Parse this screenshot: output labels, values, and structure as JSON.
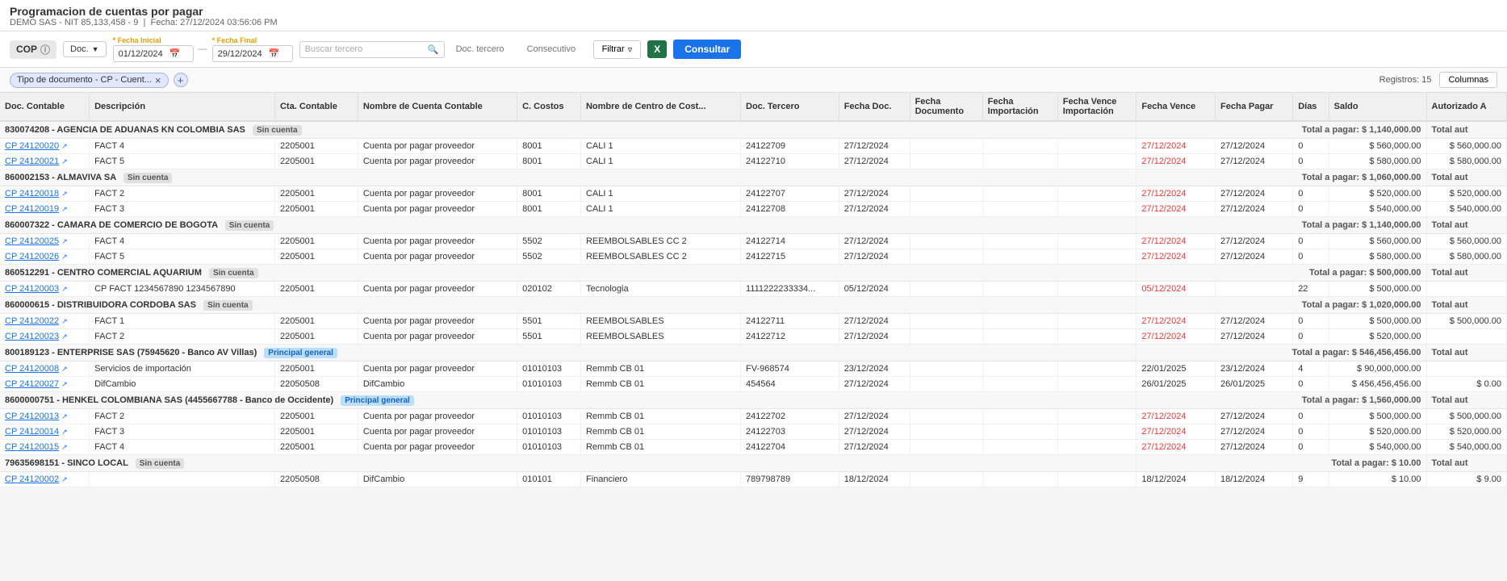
{
  "header": {
    "title": "Programacion de cuentas por pagar",
    "subtitle": "DEMO SAS - NIT 85,133,458 - 9",
    "date_label": "Fecha: 27/12/2024 03:56:06 PM"
  },
  "toolbar": {
    "currency": "COP",
    "doc_label": "Doc.",
    "fecha_inicial_label": "* Fecha Inicial",
    "fecha_inicial_value": "01/12/2024",
    "fecha_final_label": "* Fecha Final",
    "fecha_final_value": "29/12/2024",
    "buscar_tercero_placeholder": "Buscar tercero",
    "doc_tercero_placeholder": "Doc. tercero",
    "consecutivo_placeholder": "Consecutivo",
    "filtrar_label": "Filtrar",
    "consultar_label": "Consultar"
  },
  "filter_bar": {
    "tag_label": "Tipo de documento - CP - Cuent...",
    "records_label": "Registros: 15",
    "columns_label": "Columnas"
  },
  "table": {
    "columns": [
      "Doc. Contable",
      "Descripción",
      "Cta. Contable",
      "Nombre de Cuenta Contable",
      "C. Costos",
      "Nombre de Centro de Cost...",
      "Doc. Tercero",
      "Fecha Doc.",
      "Fecha Documento",
      "Fecha Importación",
      "Fecha Vence Importación",
      "Fecha Vence",
      "Fecha Pagar",
      "Días",
      "Saldo",
      "Autorizado A"
    ],
    "groups": [
      {
        "id": "g1",
        "group_label": "830074208 - AGENCIA DE ADUANAS KN COLOMBIA SAS",
        "badge": "Sin cuenta",
        "badge_type": "gray",
        "total_label": "Total a pagar: $ 1,140,000.00",
        "total_auth": "Total aut",
        "rows": [
          {
            "doc_contable": "CP 24120020",
            "descripcion": "FACT 4",
            "cta_contable": "2205001",
            "nombre_cuenta": "Cuenta por pagar proveedor",
            "c_costos": "8001",
            "nombre_centro": "CALI 1",
            "doc_tercero": "24122709",
            "fecha_doc": "27/12/2024",
            "fecha_documento": "",
            "fecha_importacion": "",
            "fecha_vence_imp": "",
            "fecha_vence": "27/12/2024",
            "fecha_pagar": "27/12/2024",
            "dias": "0",
            "saldo": "$ 560,000.00",
            "autorizado": "$ 560,000.00",
            "fecha_vence_red": true
          },
          {
            "doc_contable": "CP 24120021",
            "descripcion": "FACT 5",
            "cta_contable": "2205001",
            "nombre_cuenta": "Cuenta por pagar proveedor",
            "c_costos": "8001",
            "nombre_centro": "CALI 1",
            "doc_tercero": "24122710",
            "fecha_doc": "27/12/2024",
            "fecha_documento": "",
            "fecha_importacion": "",
            "fecha_vence_imp": "",
            "fecha_vence": "27/12/2024",
            "fecha_pagar": "27/12/2024",
            "dias": "0",
            "saldo": "$ 580,000.00",
            "autorizado": "$ 580,000.00",
            "fecha_vence_red": true
          }
        ]
      },
      {
        "id": "g2",
        "group_label": "860002153 - ALMAVIVA SA",
        "badge": "Sin cuenta",
        "badge_type": "gray",
        "total_label": "Total a pagar: $ 1,060,000.00",
        "total_auth": "Total aut",
        "rows": [
          {
            "doc_contable": "CP 24120018",
            "descripcion": "FACT 2",
            "cta_contable": "2205001",
            "nombre_cuenta": "Cuenta por pagar proveedor",
            "c_costos": "8001",
            "nombre_centro": "CALI 1",
            "doc_tercero": "24122707",
            "fecha_doc": "27/12/2024",
            "fecha_documento": "",
            "fecha_importacion": "",
            "fecha_vence_imp": "",
            "fecha_vence": "27/12/2024",
            "fecha_pagar": "27/12/2024",
            "dias": "0",
            "saldo": "$ 520,000.00",
            "autorizado": "$ 520,000.00",
            "fecha_vence_red": true
          },
          {
            "doc_contable": "CP 24120019",
            "descripcion": "FACT 3",
            "cta_contable": "2205001",
            "nombre_cuenta": "Cuenta por pagar proveedor",
            "c_costos": "8001",
            "nombre_centro": "CALI 1",
            "doc_tercero": "24122708",
            "fecha_doc": "27/12/2024",
            "fecha_documento": "",
            "fecha_importacion": "",
            "fecha_vence_imp": "",
            "fecha_vence": "27/12/2024",
            "fecha_pagar": "27/12/2024",
            "dias": "0",
            "saldo": "$ 540,000.00",
            "autorizado": "$ 540,000.00",
            "fecha_vence_red": true
          }
        ]
      },
      {
        "id": "g3",
        "group_label": "860007322 - CAMARA DE COMERCIO DE BOGOTA",
        "badge": "Sin cuenta",
        "badge_type": "gray",
        "total_label": "Total a pagar: $ 1,140,000.00",
        "total_auth": "Total aut",
        "rows": [
          {
            "doc_contable": "CP 24120025",
            "descripcion": "FACT 4",
            "cta_contable": "2205001",
            "nombre_cuenta": "Cuenta por pagar proveedor",
            "c_costos": "5502",
            "nombre_centro": "REEMBOLSABLES CC 2",
            "doc_tercero": "24122714",
            "fecha_doc": "27/12/2024",
            "fecha_documento": "",
            "fecha_importacion": "",
            "fecha_vence_imp": "",
            "fecha_vence": "27/12/2024",
            "fecha_pagar": "27/12/2024",
            "dias": "0",
            "saldo": "$ 560,000.00",
            "autorizado": "$ 560,000.00",
            "fecha_vence_red": true
          },
          {
            "doc_contable": "CP 24120026",
            "descripcion": "FACT 5",
            "cta_contable": "2205001",
            "nombre_cuenta": "Cuenta por pagar proveedor",
            "c_costos": "5502",
            "nombre_centro": "REEMBOLSABLES CC 2",
            "doc_tercero": "24122715",
            "fecha_doc": "27/12/2024",
            "fecha_documento": "",
            "fecha_importacion": "",
            "fecha_vence_imp": "",
            "fecha_vence": "27/12/2024",
            "fecha_pagar": "27/12/2024",
            "dias": "0",
            "saldo": "$ 580,000.00",
            "autorizado": "$ 580,000.00",
            "fecha_vence_red": true
          }
        ]
      },
      {
        "id": "g4",
        "group_label": "860512291 - CENTRO COMERCIAL AQUARIUM",
        "badge": "Sin cuenta",
        "badge_type": "gray",
        "total_label": "Total a pagar: $ 500,000.00",
        "total_auth": "Total aut",
        "rows": [
          {
            "doc_contable": "CP 24120003",
            "descripcion": "CP FACT 1234567890 1234567890",
            "cta_contable": "2205001",
            "nombre_cuenta": "Cuenta por pagar proveedor",
            "c_costos": "020102",
            "nombre_centro": "Tecnologia",
            "doc_tercero": "1111222233334...",
            "fecha_doc": "05/12/2024",
            "fecha_documento": "",
            "fecha_importacion": "",
            "fecha_vence_imp": "",
            "fecha_vence": "05/12/2024",
            "fecha_pagar": "",
            "dias": "22",
            "saldo": "$ 500,000.00",
            "autorizado": "",
            "fecha_vence_red": true
          }
        ]
      },
      {
        "id": "g5",
        "group_label": "860000615 - DISTRIBUIDORA CORDOBA SAS",
        "badge": "Sin cuenta",
        "badge_type": "gray",
        "total_label": "Total a pagar: $ 1,020,000.00",
        "total_auth": "Total aut",
        "rows": [
          {
            "doc_contable": "CP 24120022",
            "descripcion": "FACT 1",
            "cta_contable": "2205001",
            "nombre_cuenta": "Cuenta por pagar proveedor",
            "c_costos": "5501",
            "nombre_centro": "REEMBOLSABLES",
            "doc_tercero": "24122711",
            "fecha_doc": "27/12/2024",
            "fecha_documento": "",
            "fecha_importacion": "",
            "fecha_vence_imp": "",
            "fecha_vence": "27/12/2024",
            "fecha_pagar": "27/12/2024",
            "dias": "0",
            "saldo": "$ 500,000.00",
            "autorizado": "$ 500,000.00",
            "fecha_vence_red": true
          },
          {
            "doc_contable": "CP 24120023",
            "descripcion": "FACT 2",
            "cta_contable": "2205001",
            "nombre_cuenta": "Cuenta por pagar proveedor",
            "c_costos": "5501",
            "nombre_centro": "REEMBOLSABLES",
            "doc_tercero": "24122712",
            "fecha_doc": "27/12/2024",
            "fecha_documento": "",
            "fecha_importacion": "",
            "fecha_vence_imp": "",
            "fecha_vence": "27/12/2024",
            "fecha_pagar": "27/12/2024",
            "dias": "0",
            "saldo": "$ 520,000.00",
            "autorizado": "",
            "fecha_vence_red": true
          }
        ]
      },
      {
        "id": "g6",
        "group_label": "800189123 - ENTERPRISE SAS (75945620 - Banco AV Villas)",
        "badge": "Principal general",
        "badge_type": "blue",
        "total_label": "Total a pagar: $ 546,456,456.00",
        "total_auth": "Total aut",
        "rows": [
          {
            "doc_contable": "CP 24120008",
            "descripcion": "Servicios de importación",
            "cta_contable": "2205001",
            "nombre_cuenta": "Cuenta por pagar proveedor",
            "c_costos": "01010103",
            "nombre_centro": "Remmb CB 01",
            "doc_tercero": "FV-968574",
            "fecha_doc": "23/12/2024",
            "fecha_documento": "",
            "fecha_importacion": "",
            "fecha_vence_imp": "",
            "fecha_vence": "22/01/2025",
            "fecha_pagar": "23/12/2024",
            "dias": "4",
            "saldo": "$ 90,000,000.00",
            "autorizado": "",
            "fecha_vence_red": false
          },
          {
            "doc_contable": "CP 24120027",
            "descripcion": "DifCambio",
            "cta_contable": "22050508",
            "nombre_cuenta": "DifCambio",
            "c_costos": "01010103",
            "nombre_centro": "Remmb CB 01",
            "doc_tercero": "454564",
            "fecha_doc": "27/12/2024",
            "fecha_documento": "",
            "fecha_importacion": "",
            "fecha_vence_imp": "",
            "fecha_vence": "26/01/2025",
            "fecha_pagar": "26/01/2025",
            "dias": "0",
            "saldo": "$ 456,456,456.00",
            "autorizado": "$ 0.00",
            "fecha_vence_red": false
          }
        ]
      },
      {
        "id": "g7",
        "group_label": "8600000751 - HENKEL COLOMBIANA SAS (4455667788 - Banco de Occidente)",
        "badge": "Principal general",
        "badge_type": "blue",
        "total_label": "Total a pagar: $ 1,560,000.00",
        "total_auth": "Total aut",
        "rows": [
          {
            "doc_contable": "CP 24120013",
            "descripcion": "FACT 2",
            "cta_contable": "2205001",
            "nombre_cuenta": "Cuenta por pagar proveedor",
            "c_costos": "01010103",
            "nombre_centro": "Remmb CB 01",
            "doc_tercero": "24122702",
            "fecha_doc": "27/12/2024",
            "fecha_documento": "",
            "fecha_importacion": "",
            "fecha_vence_imp": "",
            "fecha_vence": "27/12/2024",
            "fecha_pagar": "27/12/2024",
            "dias": "0",
            "saldo": "$ 500,000.00",
            "autorizado": "$ 500,000.00",
            "fecha_vence_red": true
          },
          {
            "doc_contable": "CP 24120014",
            "descripcion": "FACT 3",
            "cta_contable": "2205001",
            "nombre_cuenta": "Cuenta por pagar proveedor",
            "c_costos": "01010103",
            "nombre_centro": "Remmb CB 01",
            "doc_tercero": "24122703",
            "fecha_doc": "27/12/2024",
            "fecha_documento": "",
            "fecha_importacion": "",
            "fecha_vence_imp": "",
            "fecha_vence": "27/12/2024",
            "fecha_pagar": "27/12/2024",
            "dias": "0",
            "saldo": "$ 520,000.00",
            "autorizado": "$ 520,000.00",
            "fecha_vence_red": true
          },
          {
            "doc_contable": "CP 24120015",
            "descripcion": "FACT 4",
            "cta_contable": "2205001",
            "nombre_cuenta": "Cuenta por pagar proveedor",
            "c_costos": "01010103",
            "nombre_centro": "Remmb CB 01",
            "doc_tercero": "24122704",
            "fecha_doc": "27/12/2024",
            "fecha_documento": "",
            "fecha_importacion": "",
            "fecha_vence_imp": "",
            "fecha_vence": "27/12/2024",
            "fecha_pagar": "27/12/2024",
            "dias": "0",
            "saldo": "$ 540,000.00",
            "autorizado": "$ 540,000.00",
            "fecha_vence_red": true
          }
        ]
      },
      {
        "id": "g8",
        "group_label": "79635698151 - SINCO LOCAL",
        "badge": "Sin cuenta",
        "badge_type": "gray",
        "total_label": "Total a pagar: $ 10.00",
        "total_auth": "Total aut",
        "rows": [
          {
            "doc_contable": "CP 24120002",
            "descripcion": "",
            "cta_contable": "22050508",
            "nombre_cuenta": "DifCambio",
            "c_costos": "010101",
            "nombre_centro": "Financiero",
            "doc_tercero": "789798789",
            "fecha_doc": "18/12/2024",
            "fecha_documento": "",
            "fecha_importacion": "",
            "fecha_vence_imp": "",
            "fecha_vence": "18/12/2024",
            "fecha_pagar": "18/12/2024",
            "dias": "9",
            "saldo": "$ 10.00",
            "autorizado": "$ 9.00",
            "fecha_vence_red": false
          }
        ]
      }
    ]
  }
}
